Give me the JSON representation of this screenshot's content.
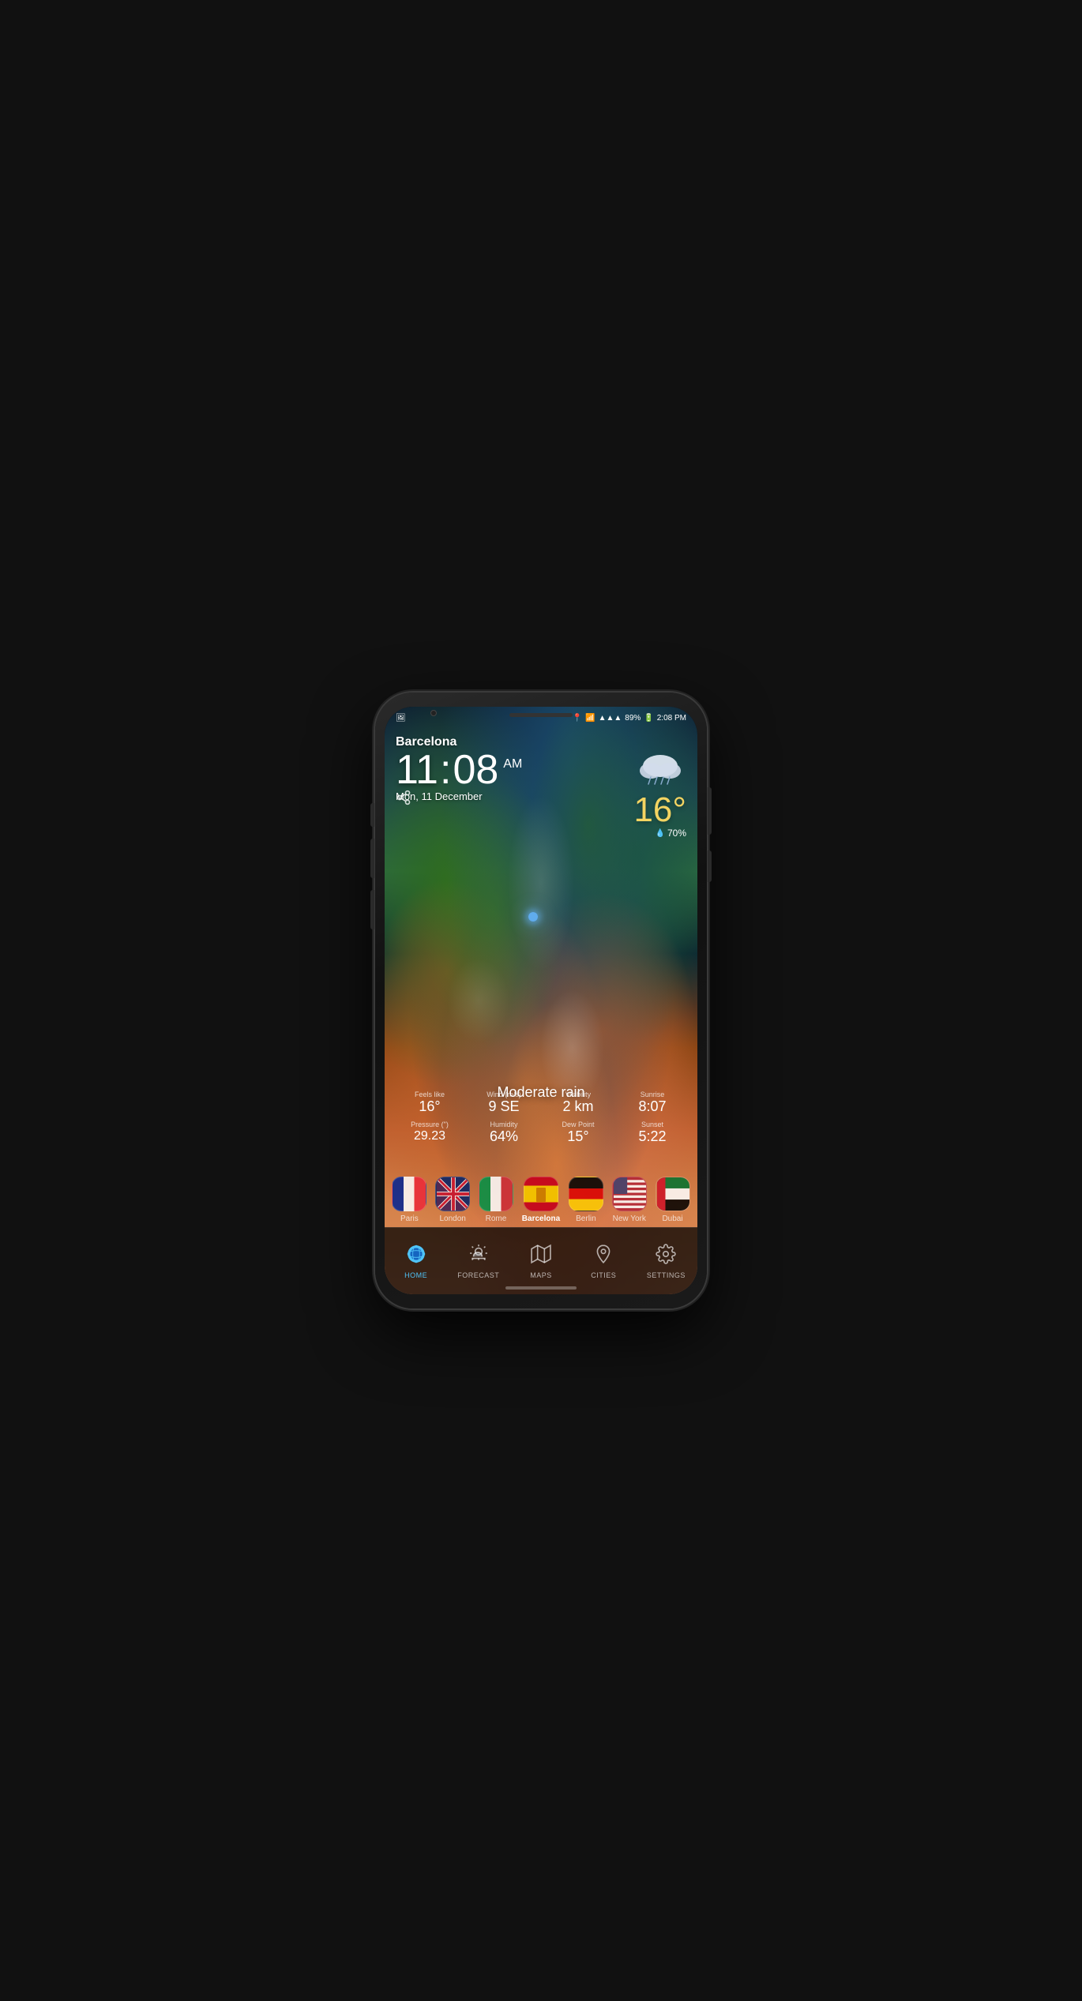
{
  "phone": {
    "status_bar": {
      "battery": "89%",
      "time": "2:08 PM",
      "signal": "▲▲▲",
      "wifi": "WiFi"
    },
    "city": "Barcelona",
    "time": {
      "hour": "11",
      "minute": "08",
      "ampm": "AM"
    },
    "date": "Mon, 11 December",
    "temperature": "16°",
    "humidity": "70%",
    "condition": "Moderate rain",
    "stats": [
      {
        "label": "Feels like",
        "value": "16°"
      },
      {
        "label": "Wind (m/s)",
        "value": "9 SE"
      },
      {
        "label": "Visibility",
        "value": "2 km"
      },
      {
        "label": "Sunrise",
        "value": "8:07"
      },
      {
        "label": "Pressure (\")",
        "value": "29.23"
      },
      {
        "label": "Humidity",
        "value": "64%"
      },
      {
        "label": "Dew Point",
        "value": "15°"
      },
      {
        "label": "Sunset",
        "value": "5:22"
      }
    ],
    "cities": [
      {
        "id": "paris",
        "label": "Paris",
        "active": false
      },
      {
        "id": "london",
        "label": "London",
        "active": false
      },
      {
        "id": "rome",
        "label": "Rome",
        "active": false
      },
      {
        "id": "barcelona",
        "label": "Barcelona",
        "active": true
      },
      {
        "id": "berlin",
        "label": "Berlin",
        "active": false
      },
      {
        "id": "newyork",
        "label": "New York",
        "active": false
      },
      {
        "id": "dubai",
        "label": "Dubai",
        "active": false
      }
    ],
    "nav": [
      {
        "id": "home",
        "label": "HOME",
        "icon": "🌍",
        "active": true
      },
      {
        "id": "forecast",
        "label": "FORECAST",
        "icon": "⛅",
        "active": false
      },
      {
        "id": "maps",
        "label": "MAPS",
        "icon": "🗺",
        "active": false
      },
      {
        "id": "cities",
        "label": "CITIES",
        "icon": "📍",
        "active": false
      },
      {
        "id": "settings",
        "label": "SETTINGS",
        "icon": "⚙",
        "active": false
      }
    ]
  }
}
